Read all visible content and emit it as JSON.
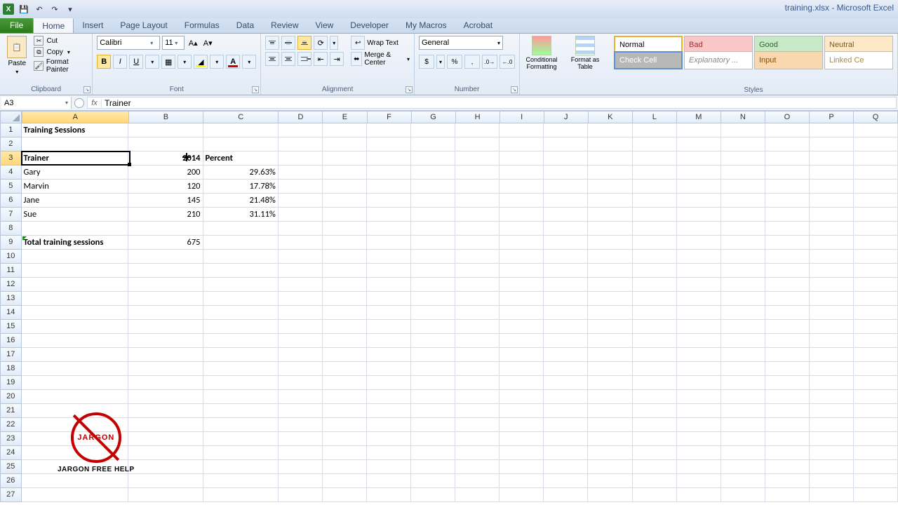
{
  "titlebar": {
    "title": "training.xlsx - Microsoft Excel"
  },
  "ribbon": {
    "file": "File",
    "tabs": [
      "Home",
      "Insert",
      "Page Layout",
      "Formulas",
      "Data",
      "Review",
      "View",
      "Developer",
      "My Macros",
      "Acrobat"
    ],
    "active_tab": "Home"
  },
  "clipboard": {
    "paste": "Paste",
    "cut": "Cut",
    "copy": "Copy",
    "format_painter": "Format Painter",
    "group": "Clipboard"
  },
  "font": {
    "name": "Calibri",
    "size": "11",
    "group": "Font"
  },
  "alignment": {
    "wrap": "Wrap Text",
    "merge": "Merge & Center",
    "group": "Alignment"
  },
  "number": {
    "format": "General",
    "group": "Number"
  },
  "styles_big": {
    "cond": "Conditional Formatting",
    "table": "Format as Table"
  },
  "cell_styles": {
    "r1": [
      "Normal",
      "Bad",
      "Good",
      "Neutral"
    ],
    "r2": [
      "Check Cell",
      "Explanatory ...",
      "Input",
      "Linked Ce"
    ],
    "group": "Styles"
  },
  "namebox": "A3",
  "formula_bar": "Trainer",
  "columns": [
    "A",
    "B",
    "C",
    "D",
    "E",
    "F",
    "G",
    "H",
    "I",
    "J",
    "K",
    "L",
    "M",
    "N",
    "O",
    "P",
    "Q"
  ],
  "grid": {
    "a1": "Training Sessions",
    "a3": "Trainer",
    "b3": "2014",
    "c3": "Percent",
    "a4": "Gary",
    "b4": "200",
    "c4": "29.63%",
    "a5": "Marvin",
    "b5": "120",
    "c5": "17.78%",
    "a6": "Jane",
    "b6": "145",
    "c6": "21.48%",
    "a7": "Sue",
    "b7": "210",
    "c7": "31.11%",
    "a9": "Total training sessions",
    "b9": "675"
  },
  "logo": {
    "word": "JARGON",
    "caption": "JARGON FREE HELP"
  }
}
